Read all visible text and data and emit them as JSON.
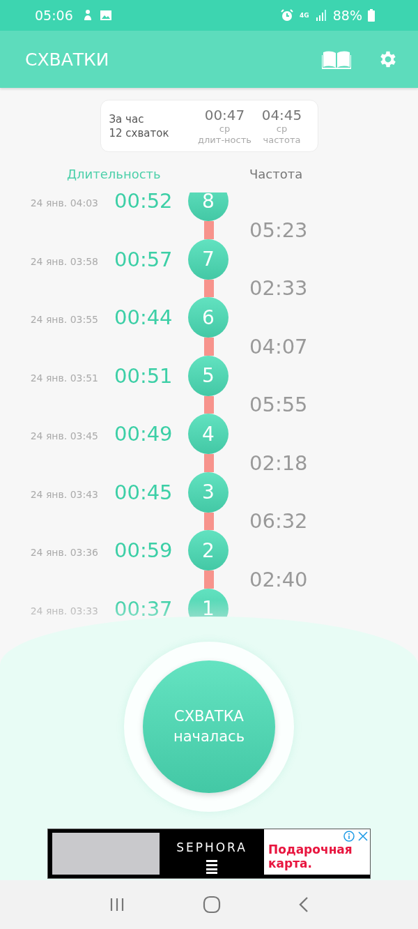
{
  "status_bar": {
    "time": "05:06",
    "battery": "88%",
    "network": "4G"
  },
  "app_bar": {
    "title": "СХВАТКИ"
  },
  "summary": {
    "period": "За час",
    "count": "12 схваток",
    "stats": [
      {
        "value": "00:47",
        "caption": [
          "ср",
          "длит-ность"
        ]
      },
      {
        "value": "04:45",
        "caption": [
          "ср",
          "частота"
        ]
      }
    ]
  },
  "columns": {
    "duration": "Длительность",
    "frequency": "Частота"
  },
  "contractions": [
    {
      "date": "24 янв. 04:03",
      "duration": "00:52",
      "number": "8",
      "frequency": "05:23"
    },
    {
      "date": "24 янв. 03:58",
      "duration": "00:57",
      "number": "7",
      "frequency": "02:33"
    },
    {
      "date": "24 янв. 03:55",
      "duration": "00:44",
      "number": "6",
      "frequency": "04:07"
    },
    {
      "date": "24 янв. 03:51",
      "duration": "00:51",
      "number": "5",
      "frequency": "05:55"
    },
    {
      "date": "24 янв. 03:45",
      "duration": "00:49",
      "number": "4",
      "frequency": "02:18"
    },
    {
      "date": "24 янв. 03:43",
      "duration": "00:45",
      "number": "3",
      "frequency": "06:32"
    },
    {
      "date": "24 янв. 03:36",
      "duration": "00:59",
      "number": "2",
      "frequency": "02:40"
    },
    {
      "date": "24 янв. 03:33",
      "duration": "00:37",
      "number": "1"
    }
  ],
  "start_button": {
    "label": "СХВАТКА\nначалась"
  },
  "ad": {
    "brand": "SEPHORA",
    "headline": "Подарочная карта."
  }
}
